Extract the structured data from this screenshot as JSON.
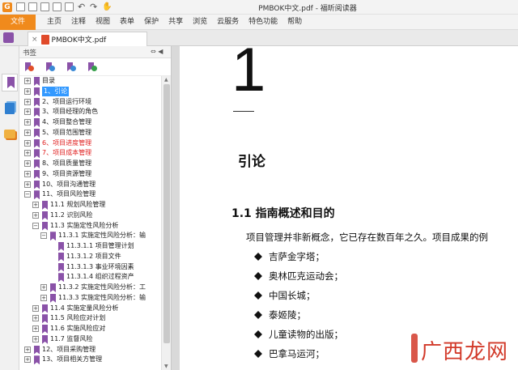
{
  "window": {
    "title": "PMBOK中文.pdf - 福昕阅读器",
    "app_logo_letter": "G"
  },
  "menu": {
    "file": "文件",
    "items": [
      "主页",
      "注释",
      "视图",
      "表单",
      "保护",
      "共享",
      "浏览",
      "云服务",
      "特色功能",
      "帮助"
    ]
  },
  "tab": {
    "close": "×",
    "label": "PMBOK中文.pdf"
  },
  "bookmarks": {
    "header": "书签",
    "collapse": "⇔ ◀",
    "tree": [
      {
        "level": 0,
        "text": "目录",
        "exp": "+"
      },
      {
        "level": 0,
        "text": "1、引论",
        "exp": "+",
        "selected": true
      },
      {
        "level": 0,
        "text": "2、项目运行环境",
        "exp": "+"
      },
      {
        "level": 0,
        "text": "3、项目经理的角色",
        "exp": "+"
      },
      {
        "level": 0,
        "text": "4、项目整合管理",
        "exp": "+"
      },
      {
        "level": 0,
        "text": "5、项目范围管理",
        "exp": "+"
      },
      {
        "level": 0,
        "text": "6、项目进度管理",
        "exp": "+",
        "red": true
      },
      {
        "level": 0,
        "text": "7、项目成本管理",
        "exp": "+",
        "red": true
      },
      {
        "level": 0,
        "text": "8、项目质量管理",
        "exp": "+"
      },
      {
        "level": 0,
        "text": "9、项目资源管理",
        "exp": "+"
      },
      {
        "level": 0,
        "text": "10、项目沟通管理",
        "exp": "+"
      },
      {
        "level": 0,
        "text": "11、项目风险管理",
        "exp": "−"
      },
      {
        "level": 1,
        "text": "11.1 规划风险管理",
        "exp": "+"
      },
      {
        "level": 1,
        "text": "11.2 识别风险",
        "exp": "+"
      },
      {
        "level": 1,
        "text": "11.3 实施定性风险分析",
        "exp": "−"
      },
      {
        "level": 2,
        "text": "11.3.1 实施定性风险分析：输",
        "exp": "−"
      },
      {
        "level": 3,
        "text": "11.3.1.1 项目管理计划",
        "exp": ""
      },
      {
        "level": 3,
        "text": "11.3.1.2 项目文件",
        "exp": ""
      },
      {
        "level": 3,
        "text": "11.3.1.3 事业环境因素",
        "exp": ""
      },
      {
        "level": 3,
        "text": "11.3.1.4 组织过程资产",
        "exp": ""
      },
      {
        "level": 2,
        "text": "11.3.2 实施定性风险分析：工",
        "exp": "+"
      },
      {
        "level": 2,
        "text": "11.3.3 实施定性风险分析：输",
        "exp": "+"
      },
      {
        "level": 1,
        "text": "11.4 实施定量风险分析",
        "exp": "+"
      },
      {
        "level": 1,
        "text": "11.5 风险应对计划",
        "exp": "+"
      },
      {
        "level": 1,
        "text": "11.6 实施风险应对",
        "exp": "+"
      },
      {
        "level": 1,
        "text": "11.7 监督风险",
        "exp": "+"
      },
      {
        "level": 0,
        "text": "12、项目采购管理",
        "exp": "+"
      },
      {
        "level": 0,
        "text": "13、项目相关方管理",
        "exp": "+"
      }
    ]
  },
  "document": {
    "chapter_number": "1",
    "chapter_title": "引论",
    "section_title": "1.1 指南概述和目的",
    "paragraph": "项目管理并非新概念，它已存在数百年之久。项目成果的例",
    "bullets": [
      "吉萨金字塔；",
      "奥林匹克运动会；",
      "中国长城；",
      "泰姬陵；",
      "儿童读物的出版；",
      "巴拿马运河；"
    ]
  },
  "watermark": "广西龙网"
}
